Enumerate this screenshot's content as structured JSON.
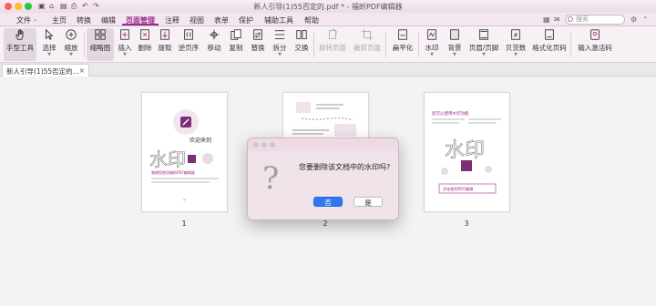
{
  "window": {
    "title": "新人引导(1)55否定的.pdf * - 福昕PDF编辑器"
  },
  "menu": {
    "items": [
      "文件",
      "主页",
      "转换",
      "编辑",
      "页面管理",
      "注释",
      "视图",
      "表单",
      "保护",
      "辅助工具",
      "帮助"
    ],
    "active_index": 4,
    "search_placeholder": "搜索"
  },
  "toolbar": {
    "tools": [
      {
        "label": "手型工具",
        "icon": "hand-icon",
        "selected": true,
        "enabled": true
      },
      {
        "label": "选择",
        "icon": "select-cursor-icon",
        "selected": false,
        "enabled": true
      },
      {
        "label": "缩放",
        "icon": "zoom-icon",
        "selected": false,
        "enabled": true
      },
      {
        "label": "缩略图",
        "icon": "thumbnail-icon",
        "selected": true,
        "enabled": true
      },
      {
        "label": "插入",
        "icon": "insert-page-icon",
        "selected": false,
        "enabled": true
      },
      {
        "label": "删除",
        "icon": "delete-page-icon",
        "selected": false,
        "enabled": true
      },
      {
        "label": "提取",
        "icon": "extract-page-icon",
        "selected": false,
        "enabled": true
      },
      {
        "label": "逆页序",
        "icon": "reverse-order-icon",
        "selected": false,
        "enabled": true
      },
      {
        "label": "移动",
        "icon": "move-page-icon",
        "selected": false,
        "enabled": true
      },
      {
        "label": "复制",
        "icon": "copy-page-icon",
        "selected": false,
        "enabled": true
      },
      {
        "label": "替换",
        "icon": "replace-page-icon",
        "selected": false,
        "enabled": true
      },
      {
        "label": "拆分",
        "icon": "split-icon",
        "selected": false,
        "enabled": true
      },
      {
        "label": "交换",
        "icon": "swap-icon",
        "selected": false,
        "enabled": true
      },
      {
        "label": "旋转页面",
        "icon": "rotate-page-icon",
        "selected": false,
        "enabled": false
      },
      {
        "label": "裁剪页面",
        "icon": "crop-page-icon",
        "selected": false,
        "enabled": false
      },
      {
        "label": "扁平化",
        "icon": "flatten-icon",
        "selected": false,
        "enabled": true
      },
      {
        "label": "水印",
        "icon": "watermark-icon",
        "selected": false,
        "enabled": true
      },
      {
        "label": "背景",
        "icon": "background-icon",
        "selected": false,
        "enabled": true
      },
      {
        "label": "页眉/页脚",
        "icon": "header-footer-icon",
        "selected": false,
        "enabled": true
      },
      {
        "label": "贝茨数",
        "icon": "bates-number-icon",
        "selected": false,
        "enabled": true
      },
      {
        "label": "格式化页码",
        "icon": "format-page-number-icon",
        "selected": false,
        "enabled": true
      },
      {
        "label": "输入激活码",
        "icon": "activation-code-icon",
        "selected": false,
        "enabled": true
      }
    ]
  },
  "tabs": {
    "doc_tab": "新人引导(1)55否定的...",
    "close": "×"
  },
  "pages": {
    "numbers": [
      "1",
      "2",
      "3"
    ],
    "page1": {
      "heading": "欢迎来到",
      "big": "水印",
      "caption": "感谢您使用福昕PDF编辑器"
    },
    "page3": {
      "heading": "您可以使用水印功能",
      "big": "水印",
      "caption": "开始使用PDF编辑"
    }
  },
  "dialog": {
    "message": "您要删除该文档中的水印吗?",
    "no_label": "否",
    "yes_label": "是",
    "icon": "question-icon"
  },
  "colors": {
    "accent": "#9a2b8c",
    "primary_button": "#2f78f0"
  }
}
